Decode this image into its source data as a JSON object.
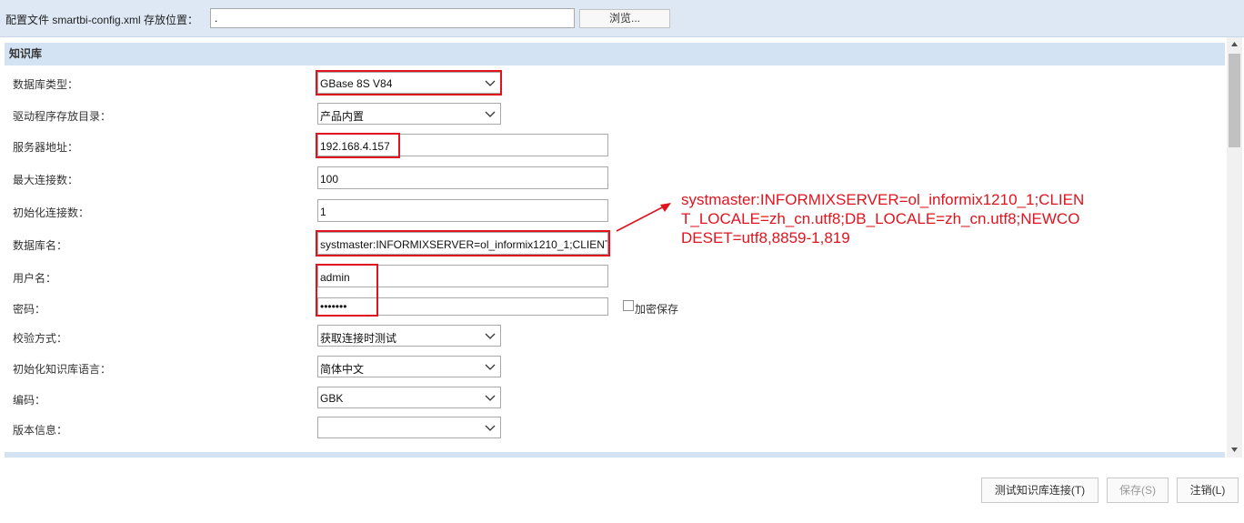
{
  "config": {
    "label": "配置文件 smartbi-config.xml 存放位置：",
    "path_value": ".",
    "browse_label": "浏览..."
  },
  "section": {
    "title": "知识库"
  },
  "form": {
    "db_type": {
      "label": "数据库类型：",
      "value": "GBase 8S V84"
    },
    "driver_dir": {
      "label": "驱动程序存放目录：",
      "value": "产品内置"
    },
    "server": {
      "label": "服务器地址：",
      "value": "192.168.4.157"
    },
    "max_conn": {
      "label": "最大连接数：",
      "value": "100"
    },
    "init_conn": {
      "label": "初始化连接数：",
      "value": "1"
    },
    "db_name": {
      "label": "数据库名：",
      "value": "systmaster:INFORMIXSERVER=ol_informix1210_1;CLIENT"
    },
    "username": {
      "label": "用户名：",
      "value": "admin"
    },
    "password": {
      "label": "密码：",
      "value": "•••••••"
    },
    "encrypt_label": "加密保存",
    "validate": {
      "label": "校验方式：",
      "value": "获取连接时测试"
    },
    "language": {
      "label": "初始化知识库语言：",
      "value": "简体中文"
    },
    "encoding": {
      "label": "编码：",
      "value": "GBK"
    },
    "version": {
      "label": "版本信息：",
      "value": ""
    }
  },
  "annotation": {
    "text": "systmaster:INFORMIXSERVER=ol_informix1210_1;CLIENT_LOCALE=zh_cn.utf8;DB_LOCALE=zh_cn.utf8;NEWCODESET=utf8,8859-1,819",
    "color": "#e0141e"
  },
  "footer": {
    "test_label": "测试知识库连接(T)",
    "save_label": "保存(S)",
    "logout_label": "注销(L)"
  }
}
